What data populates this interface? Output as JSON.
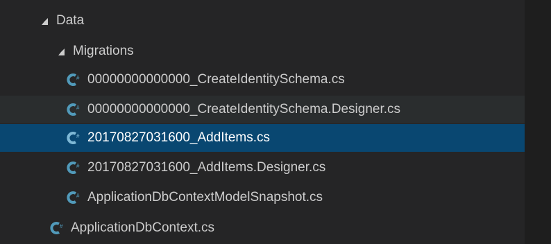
{
  "colors": {
    "background": "#252526",
    "hover": "#2a2d2e",
    "selected": "#094771",
    "text": "#cccccc",
    "icon": "#519aba"
  },
  "tree": {
    "folders": [
      {
        "label": "Data",
        "expanded": true
      },
      {
        "label": "Migrations",
        "expanded": true
      }
    ],
    "files": [
      {
        "label": "00000000000000_CreateIdentitySchema.cs",
        "icon": "csharp-icon"
      },
      {
        "label": "00000000000000_CreateIdentitySchema.Designer.cs",
        "icon": "csharp-icon",
        "state": "hover"
      },
      {
        "label": "20170827031600_AddItems.cs",
        "icon": "csharp-icon",
        "state": "selected"
      },
      {
        "label": "20170827031600_AddItems.Designer.cs",
        "icon": "csharp-icon"
      },
      {
        "label": "ApplicationDbContextModelSnapshot.cs",
        "icon": "csharp-icon"
      },
      {
        "label": "ApplicationDbContext.cs",
        "icon": "csharp-icon"
      }
    ]
  }
}
